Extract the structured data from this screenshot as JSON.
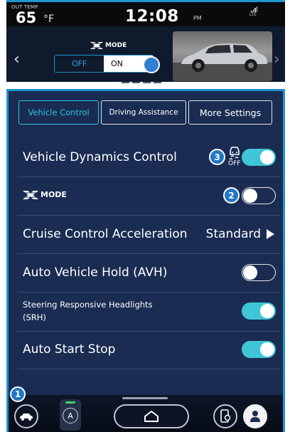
{
  "status": {
    "temp_label": "OUT TEMP",
    "temp_value": "65",
    "temp_unit": "°F",
    "time": "12:08",
    "ampm": "PM",
    "network": "LTE"
  },
  "xmode_panel": {
    "mode_label": "MODE",
    "off_label": "OFF",
    "on_label": "ON",
    "selected": "ON",
    "page_count": 5,
    "active_page": 5
  },
  "tabs": [
    {
      "label": "Vehicle Control",
      "active": true
    },
    {
      "label": "Driving Assistance",
      "active": false
    },
    {
      "label": "More Settings",
      "active": false
    }
  ],
  "settings": {
    "vdc": {
      "label": "Vehicle Dynamics Control",
      "badge": "3",
      "icon_text": "OFF",
      "enabled": true
    },
    "xmode": {
      "label": "MODE",
      "badge": "2",
      "enabled": false
    },
    "cruise": {
      "label": "Cruise Control Acceleration",
      "value": "Standard"
    },
    "avh": {
      "label": "Auto Vehicle Hold (AVH)",
      "enabled": false
    },
    "srh": {
      "label_line1": "Steering Responsive Headlights",
      "label_line2": "(SRH)",
      "enabled": true
    },
    "ass": {
      "label": "Auto Start Stop",
      "enabled": true
    }
  },
  "bottom_bar": {
    "badge": "1",
    "auto_label": "A"
  },
  "colors": {
    "accent": "#1f94cf",
    "toggle_on": "#3fc6d6",
    "panel_bg": "#1a2c52",
    "badge": "#2277c4"
  }
}
